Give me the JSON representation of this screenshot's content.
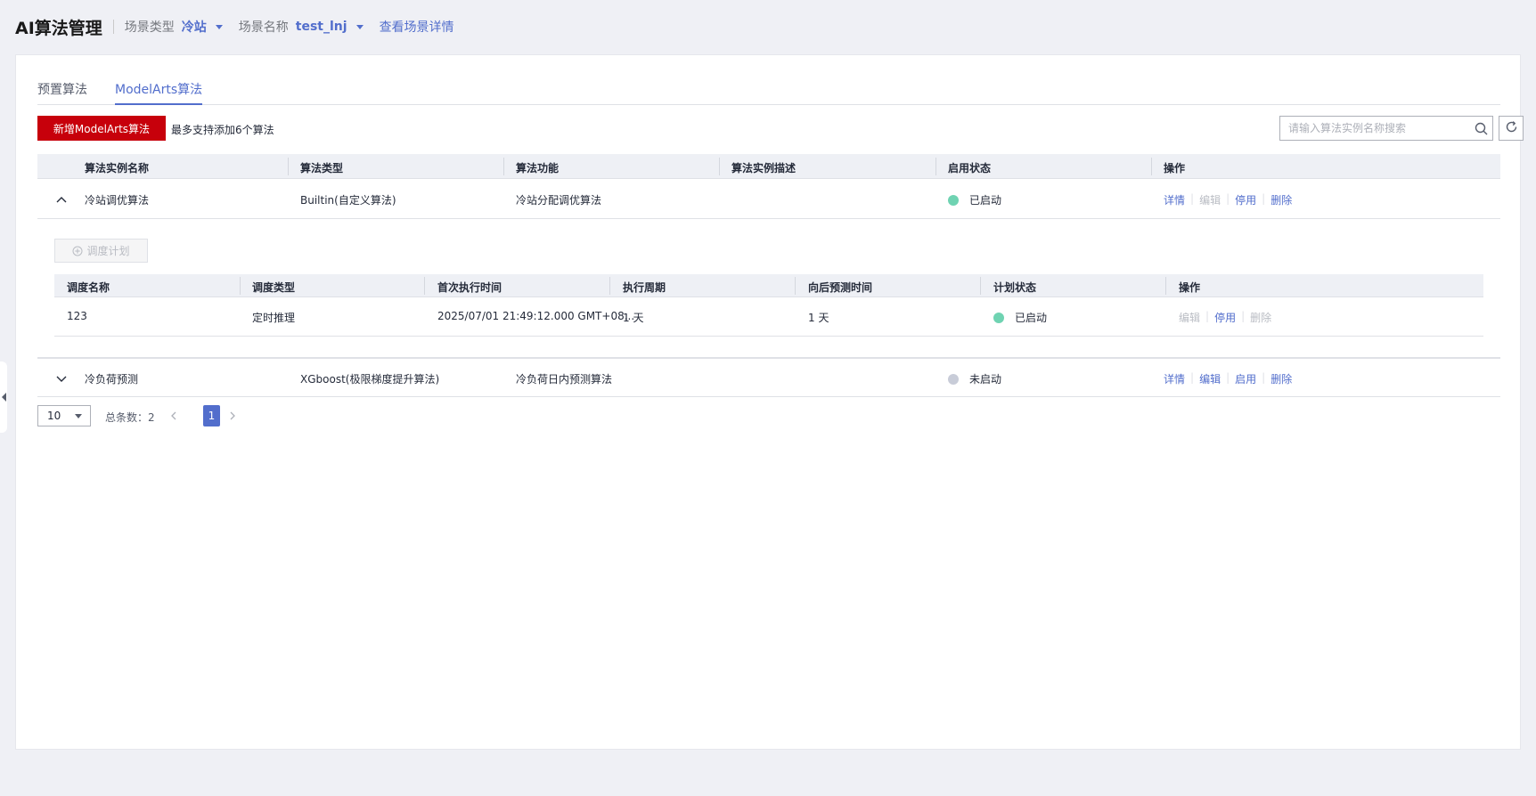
{
  "header": {
    "title": "AI算法管理",
    "scene_type_label": "场景类型",
    "scene_type_value": "冷站",
    "scene_name_label": "场景名称",
    "scene_name_value": "test_lnj",
    "view_detail_link": "查看场景详情"
  },
  "tabs": [
    {
      "label": "预置算法",
      "active": false
    },
    {
      "label": "ModelArts算法",
      "active": true
    }
  ],
  "toolbar": {
    "add_button": "新增ModelArts算法",
    "hint": "最多支持添加6个算法",
    "search_placeholder": "请输入算法实例名称搜索",
    "icons": {
      "search": "search-icon",
      "refresh": "refresh-icon"
    }
  },
  "table": {
    "columns": [
      "算法实例名称",
      "算法类型",
      "算法功能",
      "算法实例描述",
      "启用状态",
      "操作"
    ],
    "rows": [
      {
        "name": "冷站调优算法",
        "type": "Builtin(自定义算法)",
        "function": "冷站分配调优算法",
        "description": "",
        "status": "已启动",
        "status_color": "#6fd3b2",
        "expanded": true,
        "ops": [
          {
            "label": "详情",
            "enabled": true
          },
          {
            "label": "编辑",
            "enabled": false
          },
          {
            "label": "停用",
            "enabled": true
          },
          {
            "label": "删除",
            "enabled": true
          }
        ]
      },
      {
        "name": "冷负荷预测",
        "type": "XGboost(极限梯度提升算法)",
        "function": "冷负荷日内预测算法",
        "description": "",
        "status": "未启动",
        "status_color": "#c8ccd8",
        "expanded": false,
        "ops": [
          {
            "label": "详情",
            "enabled": true
          },
          {
            "label": "编辑",
            "enabled": true
          },
          {
            "label": "启用",
            "enabled": true
          },
          {
            "label": "删除",
            "enabled": true
          }
        ]
      }
    ]
  },
  "schedule": {
    "add_plan_button": "调度计划",
    "columns": [
      "调度名称",
      "调度类型",
      "首次执行时间",
      "执行周期",
      "向后预测时间",
      "计划状态",
      "操作"
    ],
    "rows": [
      {
        "name": "123",
        "type": "定时推理",
        "first_run": "2025/07/01 21:49:12.000 GMT+08...",
        "period": "1 天",
        "forecast": "1 天",
        "status": "已启动",
        "status_color": "#6fd3b2",
        "ops": [
          {
            "label": "编辑",
            "enabled": false
          },
          {
            "label": "停用",
            "enabled": true
          },
          {
            "label": "删除",
            "enabled": false
          }
        ]
      }
    ]
  },
  "pager": {
    "page_size": "10",
    "total": "总条数：2",
    "current_page": "1"
  },
  "colors": {
    "accent": "#526ecc",
    "primary_button": "#c7000b"
  }
}
